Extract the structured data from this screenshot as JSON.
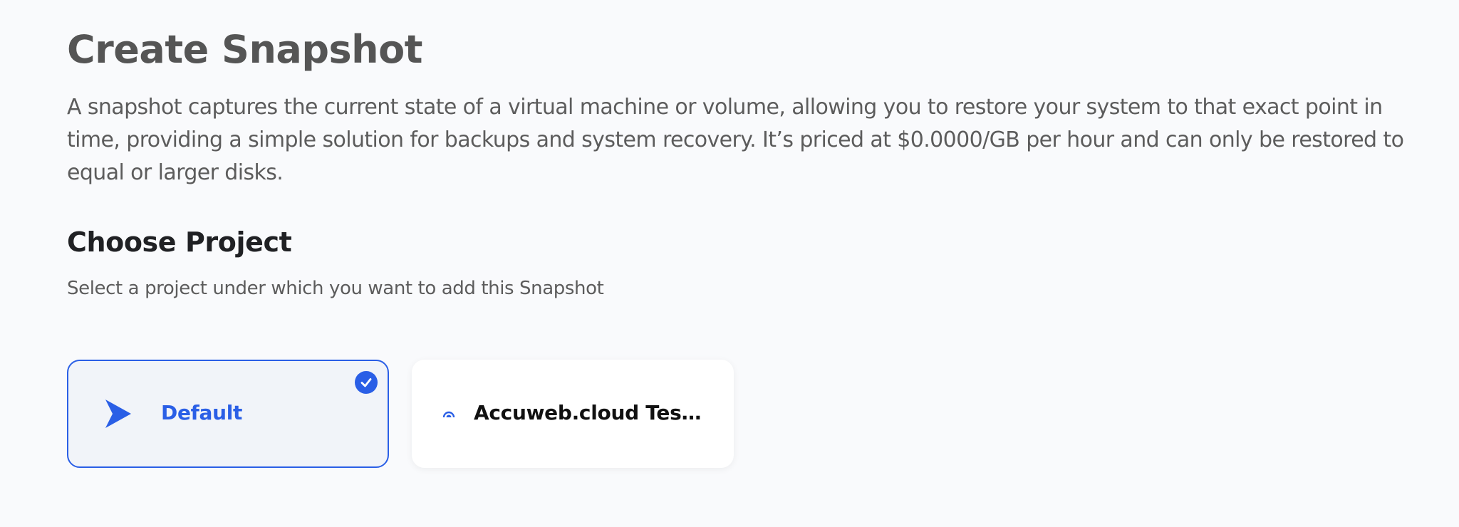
{
  "page": {
    "title": "Create Snapshot",
    "description": "A snapshot captures the current state of a virtual machine or volume, allowing you to restore your system to that exact point in time, providing a simple solution for backups and system recovery. It’s priced at $0.0000/GB per hour and can only be restored to equal or larger disks."
  },
  "project_section": {
    "title": "Choose Project",
    "subtitle": "Select a project under which you want to add this Snapshot",
    "projects": [
      {
        "label": "Default",
        "icon": "paper-plane-icon",
        "selected": true
      },
      {
        "label": "Accuweb.cloud Test P...",
        "icon": "signal-icon",
        "selected": false
      }
    ]
  },
  "colors": {
    "accent": "#2a5fe6",
    "background": "#f9fafc",
    "selected_card_bg": "#f1f4f9",
    "title_text": "#555555",
    "body_text": "#5c5c5c"
  }
}
